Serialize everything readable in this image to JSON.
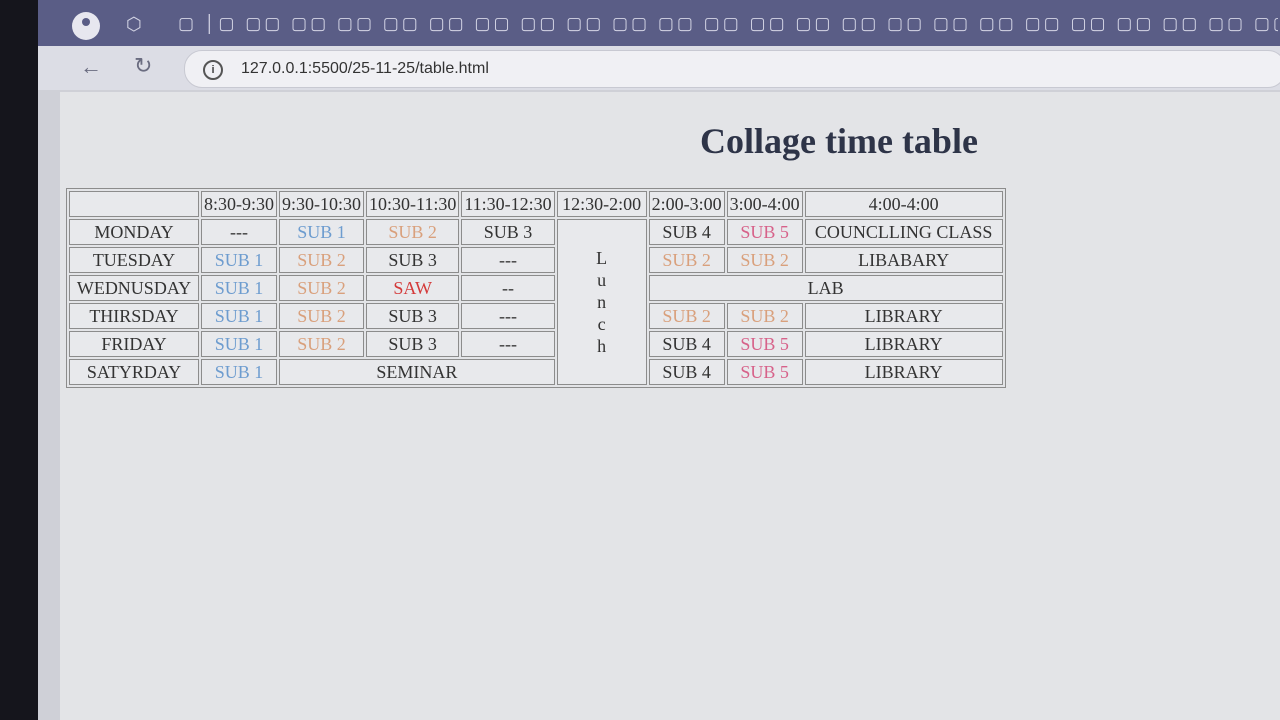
{
  "browser": {
    "url": "127.0.0.1:5500/25-11-25/table.html"
  },
  "page": {
    "title": "Collage time table"
  },
  "timetable": {
    "headers": [
      "",
      "8:30-9:30",
      "9:30-10:30",
      "10:30-11:30",
      "11:30-12:30",
      "12:30-2:00",
      "2:00-3:00",
      "3:00-4:00",
      "4:00-4:00"
    ],
    "lunch": [
      "L",
      "u",
      "n",
      "c",
      "h"
    ],
    "monday": {
      "day": "MONDAY",
      "c1": "---",
      "c2": "SUB 1",
      "c3": "SUB 2",
      "c4": "SUB 3",
      "c6": "SUB 4",
      "c7": "SUB 5",
      "c8": "COUNCLLING CLASS"
    },
    "tuesday": {
      "day": "TUESDAY",
      "c1": "SUB 1",
      "c2": "SUB 2",
      "c3": "SUB 3",
      "c4": "---",
      "c6": "SUB 2",
      "c7": "SUB 2",
      "c8": "LIBABARY"
    },
    "wednesday": {
      "day": "WEDNUSDAY",
      "c1": "SUB 1",
      "c2": "SUB 2",
      "c3": "SAW",
      "c4": "--",
      "lab": "LAB"
    },
    "thursday": {
      "day": "THIRSDAY",
      "c1": "SUB 1",
      "c2": "SUB 2",
      "c3": "SUB 3",
      "c4": "---",
      "c6": "SUB 2",
      "c7": "SUB 2",
      "c8": "LIBRARY"
    },
    "friday": {
      "day": "FRIDAY",
      "c1": "SUB 1",
      "c2": "SUB 2",
      "c3": "SUB 3",
      "c4": "---",
      "c6": "SUB 4",
      "c7": "SUB 5",
      "c8": "LIBRARY"
    },
    "saturday": {
      "day": "SATYRDAY",
      "c1": "SUB 1",
      "seminar": "SEMINAR",
      "c6": "SUB 4",
      "c7": "SUB 5",
      "c8": "LIBRARY"
    }
  },
  "colors": {
    "tab_bar": "#5a5d86",
    "sub1": "#6d9ccf",
    "sub2": "#d9a07c",
    "sub5": "#d7628a",
    "saw": "#d43a3a"
  }
}
